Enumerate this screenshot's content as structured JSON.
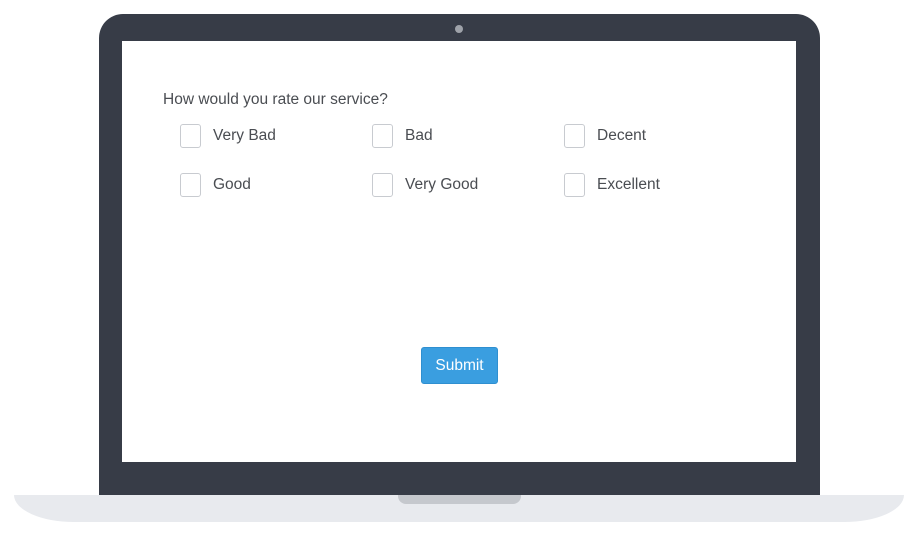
{
  "survey": {
    "question": "How would you rate our service?",
    "options": [
      {
        "label": "Very Bad",
        "checked": false
      },
      {
        "label": "Bad",
        "checked": false
      },
      {
        "label": "Decent",
        "checked": false
      },
      {
        "label": "Good",
        "checked": false
      },
      {
        "label": "Very Good",
        "checked": false
      },
      {
        "label": "Excellent",
        "checked": false
      }
    ],
    "submit_label": "Submit"
  },
  "colors": {
    "laptop_frame": "#373c47",
    "laptop_base": "#e8eaee",
    "button": "#3a9ee0",
    "text": "#4a4d52"
  }
}
